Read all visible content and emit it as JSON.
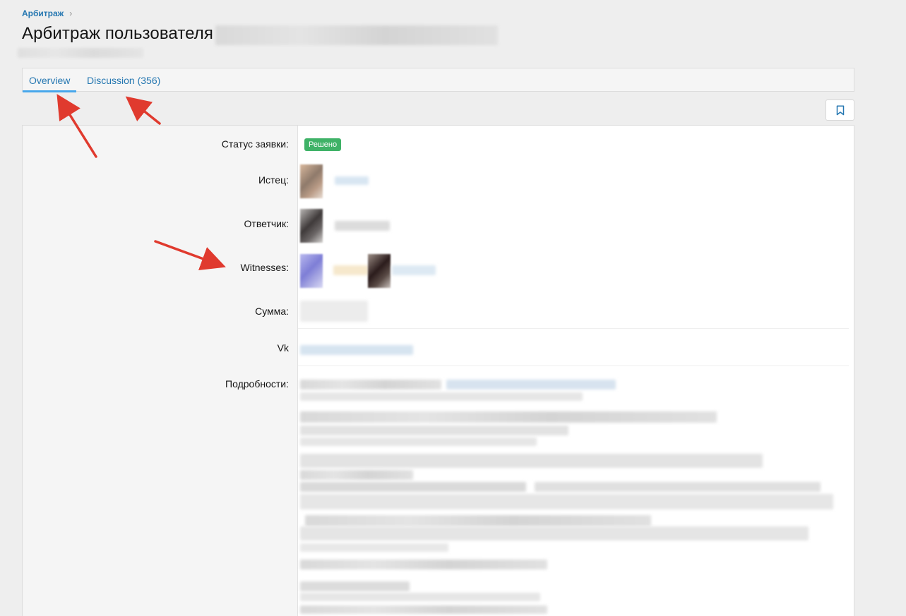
{
  "breadcrumb": {
    "items": [
      {
        "label": "Арбитраж"
      }
    ]
  },
  "page": {
    "title": "Арбитраж пользователя"
  },
  "tabs": [
    {
      "label": "Overview",
      "active": true
    },
    {
      "label": "Discussion (356)",
      "active": false
    }
  ],
  "toolbar": {
    "bookmark_icon": "bookmark-icon"
  },
  "fields": {
    "status": {
      "label": "Статус заявки:",
      "value": "Решено",
      "color": "#3fb267"
    },
    "plaintiff": {
      "label": "Истец:"
    },
    "defendant": {
      "label": "Ответчик:"
    },
    "witnesses": {
      "label": "Witnesses:"
    },
    "amount": {
      "label": "Сумма:"
    },
    "vk": {
      "label": "Vk"
    },
    "details": {
      "label": "Подробности:"
    }
  },
  "colors": {
    "link": "#2577b1",
    "tab_underline": "#47a7eb",
    "annotation_arrow": "#e03a2e"
  }
}
